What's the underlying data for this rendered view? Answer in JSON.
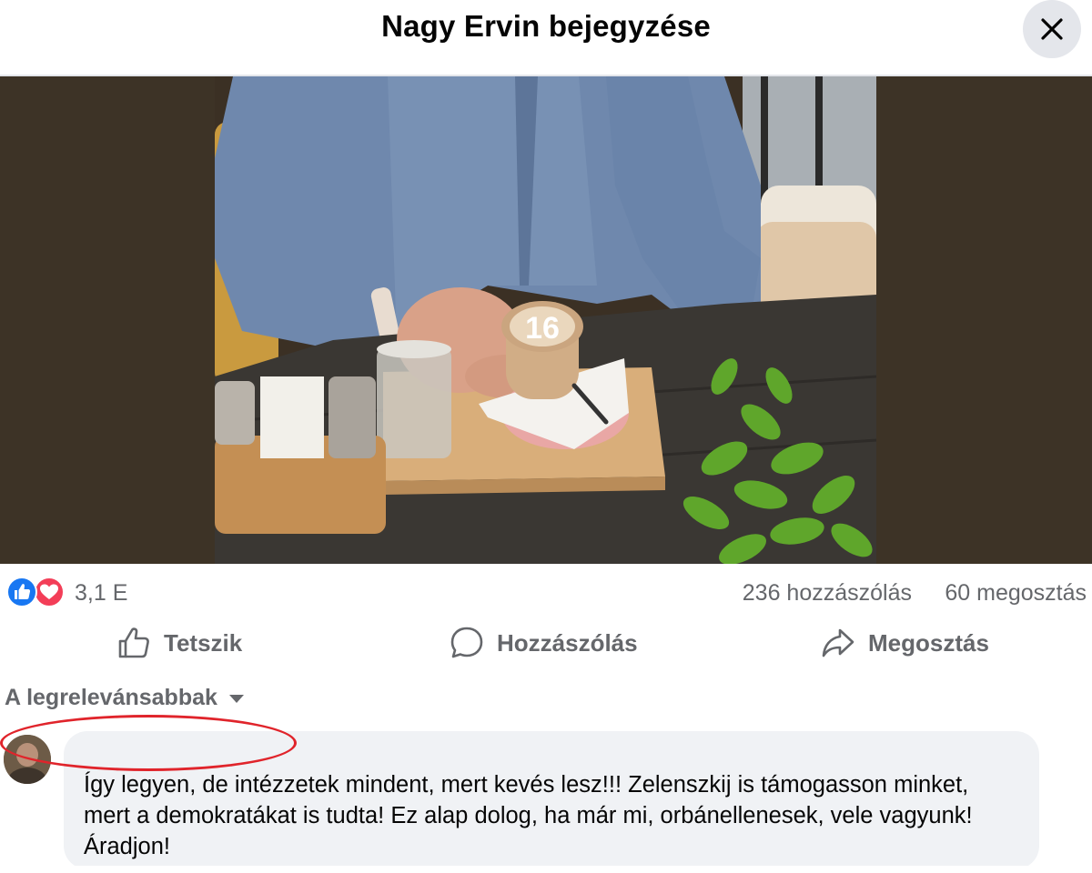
{
  "header": {
    "title": "Nagy Ervin bejegyzése",
    "close_icon": "close-icon"
  },
  "post": {
    "photo_icon": "post-photo",
    "latte_art": "16"
  },
  "stats": {
    "reactions": "3,1 E",
    "reaction_icons": [
      "like-reaction-icon",
      "love-reaction-icon"
    ],
    "comments": "236 hozzászólás",
    "shares": "60 megosztás"
  },
  "actions": {
    "like": "Tetszik",
    "comment": "Hozzászólás",
    "share": "Megosztás"
  },
  "sort": {
    "label": "A legrelevánsabbak"
  },
  "comment": {
    "author": "",
    "text": "Így legyen, de intézzetek mindent, mert kevés lesz!!! Zelenszkij is támogasson minket, mert a demokratákat is tudta! Ez alap dolog, ha már mi, orbánellenesek, vele vagyunk! Áradjon!"
  },
  "colors": {
    "secondary_text": "#65676b",
    "bubble": "#f0f2f5",
    "like_blue": "#1877f2",
    "love_red": "#f33e58",
    "highlight_red": "#e0242b"
  }
}
